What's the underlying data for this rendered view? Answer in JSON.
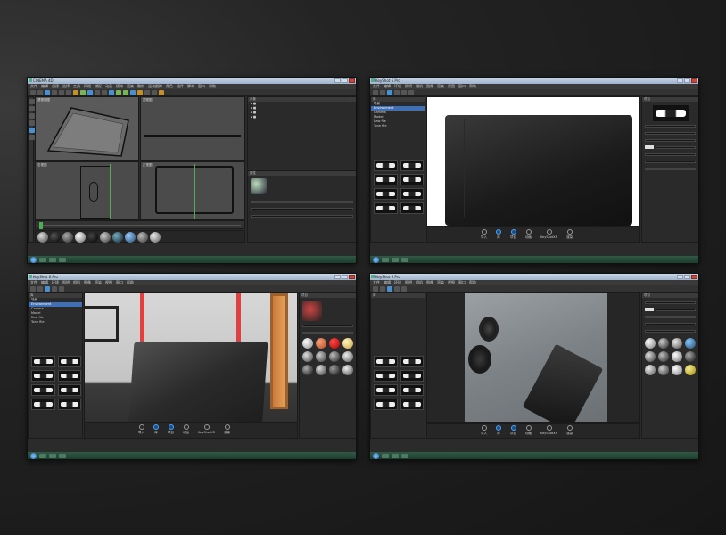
{
  "screens": [
    {
      "app": "CINEMA 4D",
      "menus": [
        "文件",
        "编辑",
        "创建",
        "选择",
        "工具",
        "网格",
        "捕捉",
        "动画",
        "模拟",
        "渲染",
        "雕刻",
        "运动跟踪",
        "角色",
        "插件",
        "脚本",
        "窗口",
        "帮助"
      ],
      "viewports": [
        "透视视图",
        "顶视图",
        "右视图",
        "正视图"
      ],
      "object_panel": "对象",
      "material_panel": "材质",
      "attr_panel": "属性"
    },
    {
      "app": "KeyShot 6 Pro",
      "menus": [
        "文件",
        "编辑",
        "环境",
        "照明",
        "相机",
        "图像",
        "渲染",
        "视图",
        "窗口",
        "帮助"
      ],
      "scene_tree": [
        "场景",
        "Environment",
        "Camera",
        "Model",
        "Raw file",
        "Tone file"
      ],
      "library_label": "库",
      "project_label": "项目",
      "nav": [
        "导入",
        "库",
        "项目",
        "动画",
        "KeyShotXR",
        "渲染"
      ]
    },
    {
      "app": "KeyShot 6 Pro",
      "menus": [
        "文件",
        "编辑",
        "环境",
        "照明",
        "相机",
        "图像",
        "渲染",
        "视图",
        "窗口",
        "帮助"
      ],
      "scene_tree": [
        "场景",
        "Environment",
        "Camera",
        "Model",
        "Raw file",
        "Tone file"
      ],
      "library_label": "库",
      "project_label": "项目",
      "nav": [
        "导入",
        "库",
        "项目",
        "动画",
        "KeyShotXR",
        "渲染"
      ]
    },
    {
      "app": "KeyShot 6 Pro",
      "menus": [
        "文件",
        "编辑",
        "环境",
        "照明",
        "相机",
        "图像",
        "渲染",
        "视图",
        "窗口",
        "帮助"
      ],
      "library_label": "库",
      "project_label": "项目",
      "nav": [
        "导入",
        "库",
        "项目",
        "动画",
        "KeyShotXR",
        "渲染"
      ]
    }
  ],
  "colors": {
    "background": "#1c1c1c",
    "app_dark": "#2b2b2b",
    "viewport_grey": "#4b4b4b",
    "selection_blue": "#3f6fb5",
    "taskbar_green": "#2f5a44",
    "accent_red": "#e04040",
    "accent_orange": "#c3902e"
  },
  "icons": [
    "start-orb-icon",
    "close-icon",
    "minimize-icon",
    "maximize-icon",
    "import-icon",
    "library-icon",
    "project-icon",
    "animation-icon",
    "keyshotxr-icon",
    "render-icon"
  ]
}
